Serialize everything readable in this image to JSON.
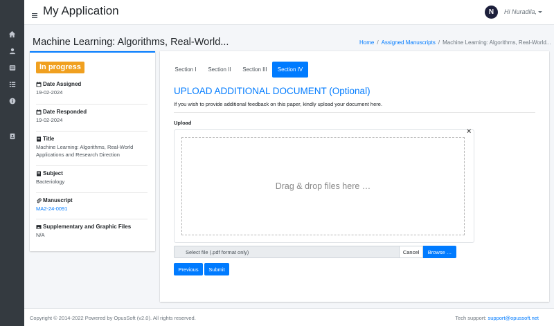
{
  "app": {
    "title": "My Application",
    "avatar_initial": "N",
    "user_greeting": "Hi Nuradila,"
  },
  "sidebar": {
    "icons": [
      "home-icon",
      "user-icon",
      "list-alt-icon",
      "list-icon",
      "info-icon",
      "id-badge-icon"
    ]
  },
  "header": {
    "page_title": "Machine Learning: Algorithms, Real-World...",
    "breadcrumb": {
      "home": "Home",
      "sep": "/",
      "assigned": "Assigned Manuscripts",
      "current": "Machine Learning: Algorithms, Real-World..."
    }
  },
  "details": {
    "status": "In progress",
    "status_color": "#f0a020",
    "date_assigned_label": "Date Assigned",
    "date_assigned": "19-02-2024",
    "date_responded_label": "Date Responded",
    "date_responded": "19-02-2024",
    "title_label": "Title",
    "title_line1": "Machine Learning: Algorithms, Real-World",
    "title_line2": "Applications and Research Direction",
    "subject_label": "Subject",
    "subject": "Bacteriology",
    "manuscript_label": "Manuscript",
    "manuscript": "MA2-24-0091",
    "supplementary_label": "Supplementary and Graphic Files",
    "supplementary": "N/A"
  },
  "tabs": [
    {
      "label": "Section I"
    },
    {
      "label": "Section II"
    },
    {
      "label": "Section III"
    },
    {
      "label": "Section IV"
    }
  ],
  "main": {
    "heading": "UPLOAD ADDITIONAL DOCUMENT (Optional)",
    "description": "If you wish to provide additional feedback on this paper, kindly upload your document here.",
    "upload_label": "Upload",
    "close_glyph": "×",
    "drop_text": "Drag & drop files here …",
    "file_placeholder": "Select file (.pdf format only)",
    "cancel_label": "Cancel",
    "browse_label": "Browse …",
    "previous_label": "Previous",
    "submit_label": "Submit"
  },
  "footer": {
    "copyright": "Copyright © 2014-2022 Powered by OpusSoft (v2.0). All rights reserved.",
    "support_label": "Tech support:",
    "support_email": "support@opussoft.net"
  },
  "colors": {
    "primary": "#007bff",
    "sidebar_bg": "#343a40",
    "status_badge": "#f0a020"
  }
}
